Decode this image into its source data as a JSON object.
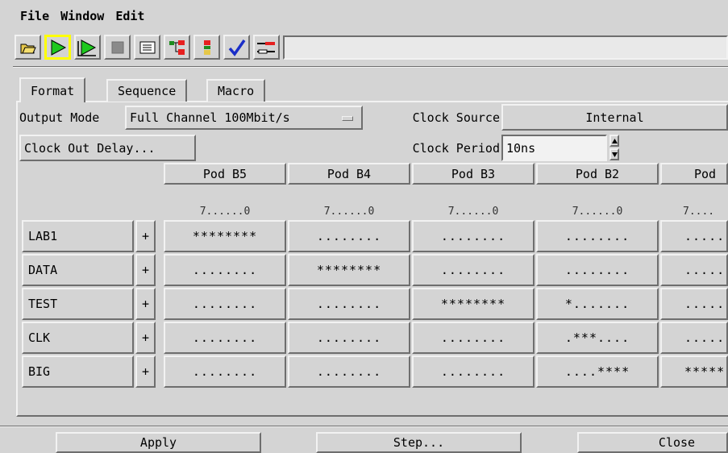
{
  "menu": {
    "file": "File",
    "window": "Window",
    "edit": "Edit"
  },
  "toolbar": {
    "icons": [
      "open-folder-icon",
      "run-icon",
      "run-repetitive-icon",
      "stop-icon",
      "listing-icon",
      "overview-icon",
      "system-icon",
      "check-icon",
      "config-icon"
    ],
    "status_field": ""
  },
  "tabs": [
    {
      "label": "Format",
      "active": true
    },
    {
      "label": "Sequence"
    },
    {
      "label": "Macro"
    }
  ],
  "output_mode": {
    "label": "Output Mode",
    "value": "Full Channel 100Mbit/s"
  },
  "clock_source": {
    "label": "Clock Source",
    "value": "Internal"
  },
  "clock_out_delay": {
    "label": "Clock Out Delay..."
  },
  "clock_period": {
    "label": "Clock Period",
    "value": "10ns"
  },
  "pods": [
    "Pod B5",
    "Pod B4",
    "Pod B3",
    "Pod B2",
    "Pod"
  ],
  "bit_range": [
    "7......0",
    "7......0",
    "7......0",
    "7......0",
    "7...."
  ],
  "labels": [
    {
      "name": "LAB1",
      "plus": "+",
      "cells": [
        "********",
        "........",
        "........",
        "........",
        "....."
      ]
    },
    {
      "name": "DATA",
      "plus": "+",
      "cells": [
        "........",
        "********",
        "........",
        "........",
        "....."
      ]
    },
    {
      "name": "TEST",
      "plus": "+",
      "cells": [
        "........",
        "........",
        "********",
        "*.......",
        "....."
      ]
    },
    {
      "name": "CLK",
      "plus": "+",
      "cells": [
        "........",
        "........",
        "........",
        ".***....",
        "....."
      ]
    },
    {
      "name": "BIG",
      "plus": "+",
      "cells": [
        "........",
        "........",
        "........",
        "....****",
        "*****"
      ]
    }
  ],
  "buttons": {
    "apply": "Apply",
    "step": "Step...",
    "close": "Close"
  }
}
